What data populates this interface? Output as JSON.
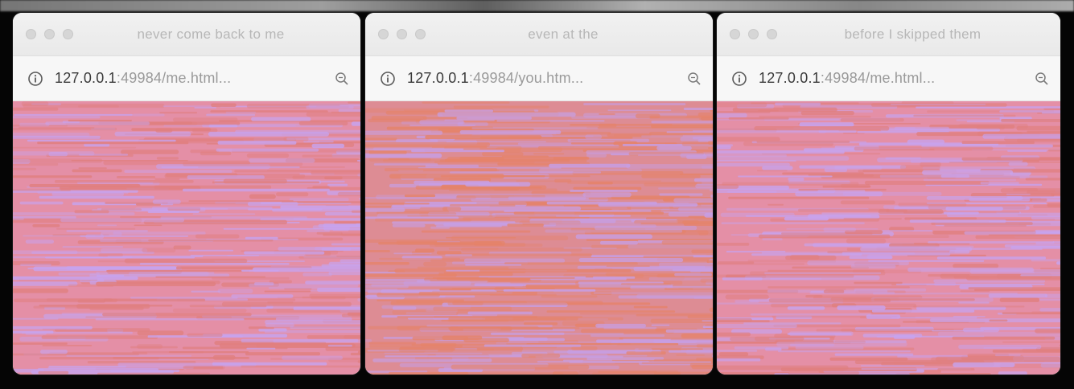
{
  "windows": [
    {
      "title": "never come back to me",
      "url_host": "127.0.0.1",
      "url_rest": ":49984/me.html...",
      "pattern": {
        "base": "#e48fa6",
        "light": "#c7a3ee",
        "dark": "#e07f7f"
      }
    },
    {
      "title": "even at the",
      "url_host": "127.0.0.1",
      "url_rest": ":49984/you.htm...",
      "pattern": {
        "base": "#dd8c94",
        "light": "#c69fe6",
        "dark": "#e5836a"
      }
    },
    {
      "title": "before I skipped them",
      "url_host": "127.0.0.1",
      "url_rest": ":49984/me.html...",
      "pattern": {
        "base": "#e48fa6",
        "light": "#c7a3ee",
        "dark": "#e07f7f"
      }
    }
  ],
  "icons": {
    "site_info": "info-circle-icon",
    "zoom": "magnifier-icon",
    "window_controls": "traffic-light-icons"
  }
}
